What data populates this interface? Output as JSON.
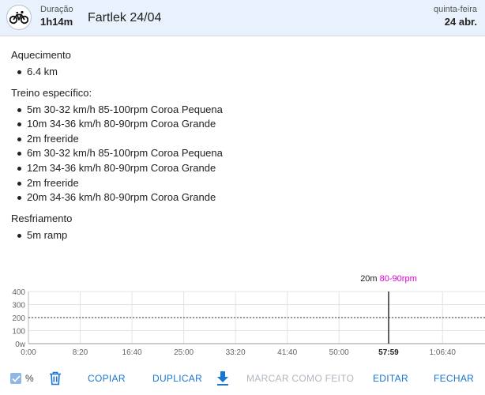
{
  "header": {
    "sport_icon": "bicycle-icon",
    "duration_label": "Duração",
    "duration_value": "1h14m",
    "title": "Fartlek 24/04",
    "day_of_week": "quinta-feira",
    "date": "24 abr."
  },
  "sections": [
    {
      "title": "Aquecimento",
      "items": [
        "6.4 km"
      ]
    },
    {
      "title": "Treino específico:",
      "items": [
        "5m 30-32 km/h 85-100rpm Coroa Pequena",
        "10m 34-36 km/h 80-90rpm Coroa Grande",
        "2m freeride",
        "6m 30-32 km/h 85-100rpm Coroa Pequena",
        "12m 34-36 km/h 80-90rpm Coroa Grande",
        "2m freeride",
        "20m 34-36 km/h 80-90rpm Coroa Grande"
      ]
    },
    {
      "title": "Resfriamento",
      "items": [
        "5m ramp"
      ]
    }
  ],
  "chart_data": {
    "type": "line",
    "y_ticks": [
      "400",
      "300",
      "200",
      "100",
      "0w"
    ],
    "ylim": [
      0,
      400
    ],
    "x_ticks": [
      "0:00",
      "8:20",
      "16:40",
      "25:00",
      "33:20",
      "41:40",
      "50:00",
      "57:59",
      "1:06:40"
    ],
    "x_tick_minutes": [
      0,
      8.333,
      16.667,
      25,
      33.333,
      41.667,
      50,
      57.983,
      66.667
    ],
    "xlim_minutes": [
      0,
      73.5
    ],
    "reference_line": {
      "value": 200,
      "style": "dotted"
    },
    "cursor": {
      "x_minutes": 57.983,
      "x_label": "57:59",
      "label": "20m",
      "label_highlight": "80-90rpm",
      "highlight_color": "#e000d8"
    },
    "grid": true
  },
  "footer": {
    "percent_checked": true,
    "percent_label": "%",
    "trash_icon": "trash-icon",
    "copy_label": "COPIAR",
    "duplicate_label": "DUPLICAR",
    "download_icon": "download-icon",
    "mark_done_label": "MARCAR COMO FEITO",
    "edit_label": "EDITAR",
    "close_label": "FECHAR"
  },
  "colors": {
    "accent": "#1976d2",
    "header_bg": "#e8f1fc",
    "disabled": "#b0b7bf",
    "highlight": "#e000d8"
  }
}
